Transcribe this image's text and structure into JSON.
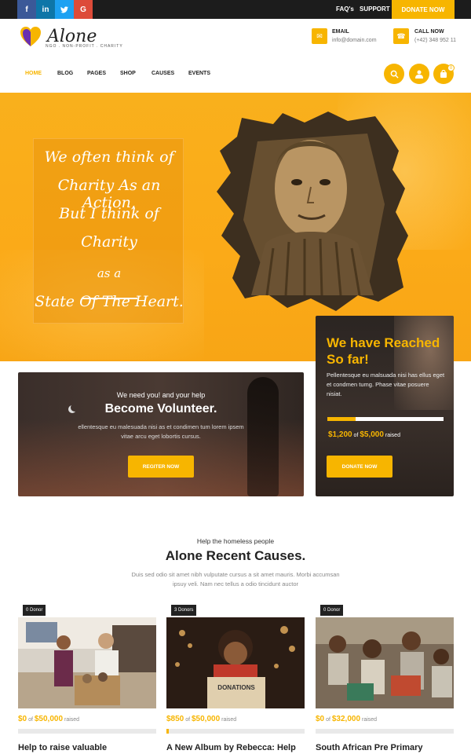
{
  "topbar": {
    "social": [
      {
        "icon": "facebook-icon",
        "glyph": "f"
      },
      {
        "icon": "linkedin-icon",
        "glyph": "in"
      },
      {
        "icon": "twitter-icon",
        "glyph": "🐦"
      },
      {
        "icon": "google-icon",
        "glyph": "G"
      }
    ],
    "faq_label": "FAQ's",
    "support_label": "SUPPORT",
    "donate_label": "DONATE NOW"
  },
  "header": {
    "logo_text": "Alone",
    "logo_tagline": "NGO . NON-PROFIT . CHARITY",
    "email_label": "EMAIL",
    "email_value": "info@domain.com",
    "phone_label": "CALL NOW",
    "phone_value": "(+42) 348 952 11"
  },
  "nav": {
    "items": [
      {
        "label": "HOME",
        "active": true
      },
      {
        "label": "BLOG"
      },
      {
        "label": "PAGES"
      },
      {
        "label": "SHOP"
      },
      {
        "label": "CAUSES"
      },
      {
        "label": "EVENTS"
      }
    ],
    "cart_count": "0"
  },
  "hero": {
    "quote_lines": [
      "We often think of",
      "Charity As an Action,",
      "But I think of",
      "Charity",
      "as a",
      "State Of The Heart."
    ]
  },
  "volunteer": {
    "kicker": "We need you! and your help",
    "title": "Become Volunteer.",
    "body": "ellentesque eu malesuada nisi as et condimen tum lorem ipsem vitae arcu eget lobortis cursus.",
    "button": "REGITER NOW"
  },
  "reached": {
    "title": "We have Reached So far!",
    "body": "Pellentesque eu malsuada nisi has ellus eget et condmen tumg. Phase vitae posuere nisiat.",
    "raised_amount": "$1,200",
    "of_text": "of",
    "goal_amount": "$5,000",
    "raised_word": "raised",
    "progress": 0.24,
    "button": "DONATE NOW"
  },
  "causes_section": {
    "kicker": "Help the homeless people",
    "title": "Alone Recent Causes.",
    "body": "Duis sed odio sit amet nibh vulputate cursus a sit amet mauris. Morbi accumsan ipsuy veli. Nam nec tellus a odio tincidunt auctor",
    "causes": [
      {
        "badge": "0 Donor",
        "raised": "$0",
        "of_text": "of",
        "goal": "$50,000",
        "raised_word": "raised",
        "title": "Help to raise valuable",
        "progress": 0
      },
      {
        "badge": "3 Donors",
        "raised": "$850",
        "of_text": "of",
        "goal": "$50,000",
        "raised_word": "raised",
        "title": "A New Album by Rebecca: Help",
        "progress": 0.017
      },
      {
        "badge": "0 Donor",
        "raised": "$0",
        "of_text": "of",
        "goal": "$32,000",
        "raised_word": "raised",
        "title": "South African Pre Primary",
        "progress": 0
      }
    ]
  },
  "colors": {
    "accent": "#f7b500",
    "topbar": "#1c1c1c",
    "dark_card": "#2b2522"
  }
}
